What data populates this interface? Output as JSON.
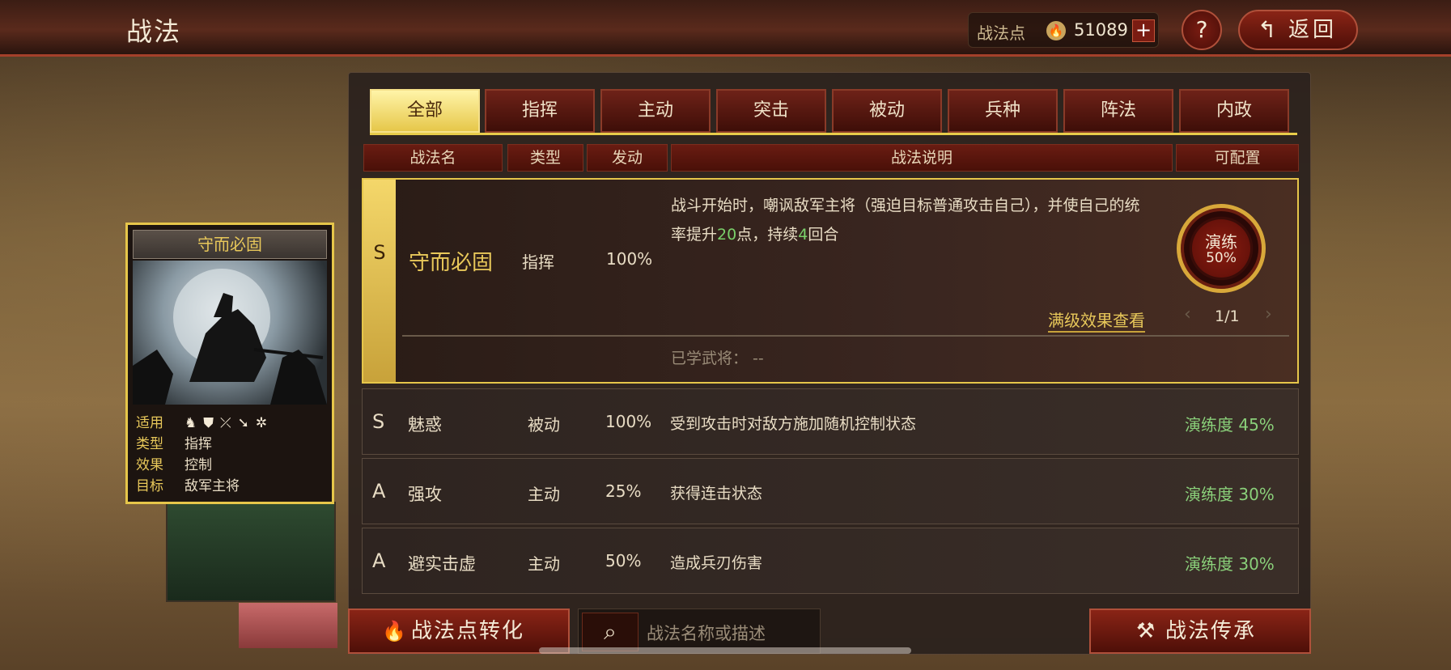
{
  "header": {
    "title": "战法",
    "points_label": "战法点",
    "points_value": "51089",
    "add_symbol": "+",
    "help_symbol": "?",
    "back_label": "返回"
  },
  "tabs": [
    "全部",
    "指挥",
    "主动",
    "突击",
    "被动",
    "兵种",
    "阵法",
    "内政"
  ],
  "active_tab": "全部",
  "columns": {
    "name": "战法名",
    "type": "类型",
    "trigger": "发动",
    "desc": "战法说明",
    "config": "可配置"
  },
  "selected": {
    "grade": "S",
    "name": "守而必固",
    "type": "指挥",
    "rate": "100%",
    "desc_part1": "战斗开始时，嘲讽敌军主将（强迫目标普通攻击自己），并使自己的统率提升",
    "desc_num1": "20",
    "desc_part2": "点，持续",
    "desc_num2": "4",
    "desc_part3": "回合",
    "drill_title": "演练",
    "drill_pct": "50%",
    "max_level_link": "满级效果查看",
    "page_text": "1/1",
    "learned": "已学武将：  --"
  },
  "rows": [
    {
      "grade": "S",
      "name": "魅惑",
      "type": "被动",
      "rate": "100%",
      "desc": "受到攻击时对敌方施加随机控制状态",
      "drill": "演练度 45%"
    },
    {
      "grade": "A",
      "name": "强攻",
      "type": "主动",
      "rate": "25%",
      "desc": "获得连击状态",
      "drill": "演练度 30%"
    },
    {
      "grade": "A",
      "name": "避实击虚",
      "type": "主动",
      "rate": "50%",
      "desc": "造成兵刃伤害",
      "drill": "演练度 30%"
    }
  ],
  "card": {
    "title": "守而必固",
    "apply_label": "适用",
    "type_label": "类型",
    "type_value": "指挥",
    "effect_label": "效果",
    "effect_value": "控制",
    "target_label": "目标",
    "target_value": "敌军主将",
    "unit_icons": [
      "cavalry-icon",
      "shield-icon",
      "bow-icon",
      "spear-icon",
      "chariot-icon"
    ]
  },
  "bottom": {
    "convert_label": "战法点转化",
    "search_placeholder": "战法名称或描述",
    "inherit_label": "战法传承"
  }
}
